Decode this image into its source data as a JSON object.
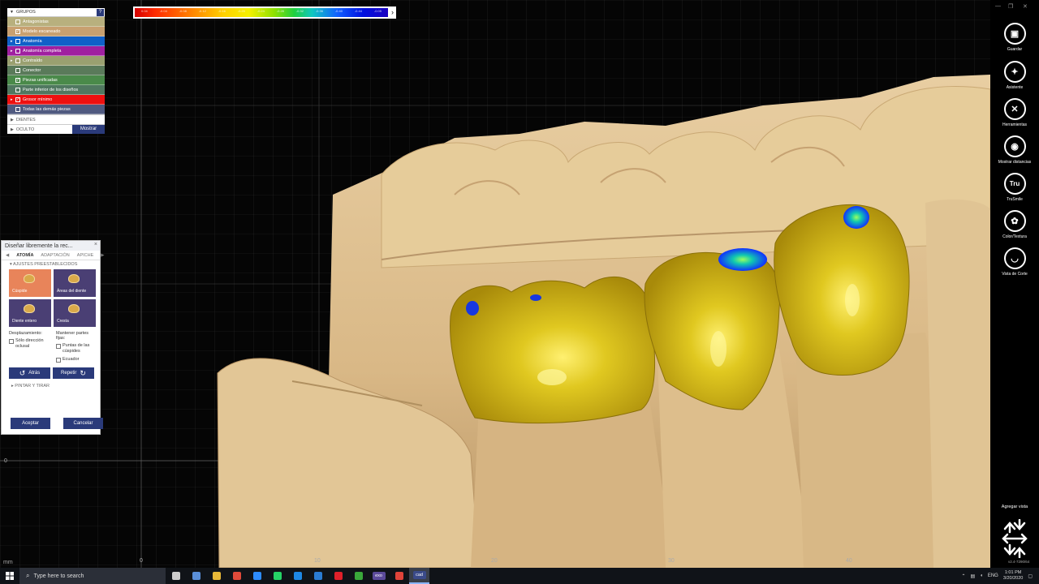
{
  "colorbar": {
    "ticks": [
      "0.04",
      "-0.04",
      "-0.08",
      "-0.12",
      "-0.16",
      "-0.20",
      "-0.24",
      "-0.28",
      "-0.32",
      "-0.36",
      "-0.40",
      "-0.44",
      "-0.05"
    ],
    "arrow": "›"
  },
  "groups": {
    "header": "GRUPOS",
    "help": "?",
    "items": [
      {
        "label": "Antagonistas",
        "color": "#b8b07e",
        "checked": false,
        "expandable": false
      },
      {
        "label": "Modelo escaneado",
        "color": "#c8a070",
        "checked": true,
        "expandable": false
      },
      {
        "label": "Anatomía",
        "color": "#1060c8",
        "checked": false,
        "expandable": true
      },
      {
        "label": "Anatomía completa",
        "color": "#a020a0",
        "checked": false,
        "expandable": true
      },
      {
        "label": "Contraído",
        "color": "#9aa070",
        "checked": false,
        "expandable": true
      },
      {
        "label": "Conector",
        "color": "#5a7a5a",
        "checked": false,
        "expandable": false
      },
      {
        "label": "Piezas unificadas",
        "color": "#4a8a4a",
        "checked": true,
        "expandable": false
      },
      {
        "label": "Parte inferior de los diseños",
        "color": "#507860",
        "checked": false,
        "expandable": false
      },
      {
        "label": "Grosor mínimo",
        "color": "#ee1010",
        "checked": true,
        "expandable": true
      },
      {
        "label": "Todas las demás piezas",
        "color": "#505a80",
        "checked": false,
        "expandable": false
      }
    ],
    "dientes": "DIENTES",
    "oculto": "OCULTO",
    "mostrar": "Mostrar"
  },
  "dialog": {
    "title": "Diseñar libremente la rec...",
    "close": "×",
    "tabs": [
      "ATOMÍA",
      "ADAPTACIÓN",
      "APICHE"
    ],
    "section": "AJUSTES PREESTABLECIDOS",
    "presets": [
      {
        "label": "Cúspide",
        "active": true
      },
      {
        "label": "Áreas del diente",
        "active": false
      },
      {
        "label": "Diente entero",
        "active": false
      },
      {
        "label": "Cresta",
        "active": false
      }
    ],
    "desplazamiento": "Desplazamiento:",
    "solo_direccion": "Sólo dirección oclusal",
    "mantener": "Mantener partes fijas:",
    "puntas": "Puntas de las cúspides",
    "ecuador": "Ecuador",
    "atras": "Atrás",
    "repetir": "Repetir",
    "pintar": "PINTAR Y TIRAR",
    "aceptar": "Aceptar",
    "cancelar": "Cancelar"
  },
  "axes": {
    "x_ticks": [
      "0",
      "10",
      "20",
      "30",
      "40"
    ],
    "unit": "mm",
    "y_zero": "0"
  },
  "toolbar": {
    "tools": [
      {
        "label": "Guardar",
        "icon": "save-icon",
        "glyph": "▣"
      },
      {
        "label": "Asistente",
        "icon": "wand-icon",
        "glyph": "✦"
      },
      {
        "label": "Herramientas",
        "icon": "tools-icon",
        "glyph": "✕"
      },
      {
        "label": "Mostrar distancias",
        "icon": "distance-icon",
        "glyph": "◉"
      },
      {
        "label": "TruSmile",
        "icon": "trusmile-icon",
        "glyph": "Tru"
      },
      {
        "label": "Color/Textura",
        "icon": "palette-icon",
        "glyph": "✿"
      },
      {
        "label": "Vista de Corte",
        "icon": "section-view-icon",
        "glyph": "◡"
      }
    ],
    "add_view": "Agregar vista",
    "version": "v2.4-7290/64"
  },
  "taskbar": {
    "search_placeholder": "Type here to search",
    "apps": [
      {
        "name": "task-view",
        "color": "#cccccc"
      },
      {
        "name": "app-browser",
        "color": "#5a8fd8"
      },
      {
        "name": "file-explorer",
        "color": "#e8b838"
      },
      {
        "name": "chrome",
        "color": "#e04a3a"
      },
      {
        "name": "zoom",
        "color": "#2d8cff"
      },
      {
        "name": "whatsapp",
        "color": "#25d366"
      },
      {
        "name": "messenger",
        "color": "#1e88e5"
      },
      {
        "name": "word-doc",
        "color": "#2b7cd3"
      },
      {
        "name": "opera",
        "color": "#e0202a"
      },
      {
        "name": "camtasia",
        "color": "#3aa83a"
      },
      {
        "name": "exocad",
        "color": "#5b4a9a",
        "text": "exo"
      },
      {
        "name": "pdf",
        "color": "#e0443a"
      },
      {
        "name": "cad",
        "color": "#3a4a8a",
        "text": "cad"
      }
    ],
    "lang": "ENG",
    "time": "1:01 PM",
    "date": "3/20/2020"
  }
}
